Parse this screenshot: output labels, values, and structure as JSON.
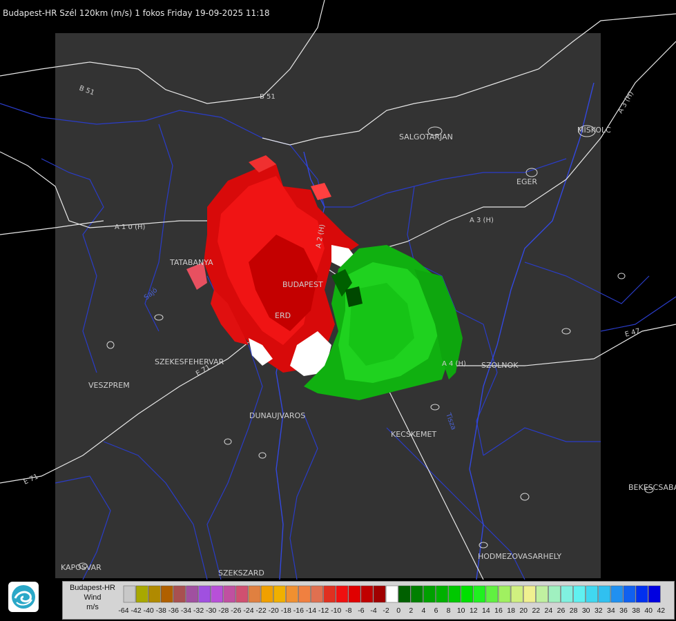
{
  "header": {
    "title": "Budapest-HR Szél 120km (m/s) 1 fokos Friday 19-09-2025 11:18"
  },
  "map": {
    "cities": [
      {
        "name": "SALGOTARJAN"
      },
      {
        "name": "MISKOLC"
      },
      {
        "name": "EGER"
      },
      {
        "name": "TATABANYA"
      },
      {
        "name": "BUDAPEST"
      },
      {
        "name": "ERD"
      },
      {
        "name": "SZEKESFEHERVAR"
      },
      {
        "name": "VESZPREM"
      },
      {
        "name": "DUNAUJVAROS"
      },
      {
        "name": "KECSKEMET"
      },
      {
        "name": "SZOLNOK"
      },
      {
        "name": "BEKESCSABA"
      },
      {
        "name": "HODMEZOVASARHELY"
      },
      {
        "name": "KAPOSVAR"
      },
      {
        "name": "SZEKSZARD"
      }
    ],
    "roads": [
      "B 51",
      "B 51",
      "A 1 0 (H)",
      "A 3 (H)",
      "A 3 (H)",
      "A 4 (H)",
      "E 71",
      "E 71",
      "E 47",
      "A 2 (H)"
    ],
    "rivers": [
      "Tisza",
      "Sajó"
    ],
    "colors": {
      "background": "#000000",
      "coverage": "#333333",
      "border_line": "#ffffff",
      "river_line": "#2a3cc8",
      "contour_line": "#d8d8d8",
      "outbound_red": "#e01010",
      "inbound_green": "#10b010"
    }
  },
  "legend": {
    "title": "Budapest-HR",
    "product": "Wind",
    "unit": "m/s",
    "icon": "omsz-logo-icon",
    "values": [
      "-64",
      "-42",
      "-40",
      "-38",
      "-36",
      "-34",
      "-32",
      "-30",
      "-28",
      "-26",
      "-24",
      "-22",
      "-20",
      "-18",
      "-16",
      "-14",
      "-12",
      "-10",
      "-8",
      "-6",
      "-4",
      "-2",
      "0",
      "2",
      "4",
      "6",
      "8",
      "10",
      "12",
      "14",
      "16",
      "18",
      "20",
      "22",
      "24",
      "26",
      "28",
      "30",
      "32",
      "34",
      "36",
      "38",
      "40",
      "42"
    ],
    "swatches": [
      "#c8c8c8",
      "#a8a800",
      "#b08a00",
      "#b06000",
      "#a85050",
      "#a050a0",
      "#a050e0",
      "#b850d8",
      "#c050a0",
      "#d05070",
      "#e08040",
      "#f0a000",
      "#f0b000",
      "#f09030",
      "#f08040",
      "#e07050",
      "#e03020",
      "#f01010",
      "#e00000",
      "#c00000",
      "#a00000",
      "#ffffff",
      "#006000",
      "#008000",
      "#00a000",
      "#00b000",
      "#00c800",
      "#00e000",
      "#20f020",
      "#60f040",
      "#a0f060",
      "#d0f080",
      "#f0f090",
      "#c0f0a0",
      "#a0f0c0",
      "#80f0e0",
      "#60f0f0",
      "#40d8f0",
      "#30c0f0",
      "#2090f0",
      "#1060f0",
      "#0030f0",
      "#0000e0"
    ]
  }
}
